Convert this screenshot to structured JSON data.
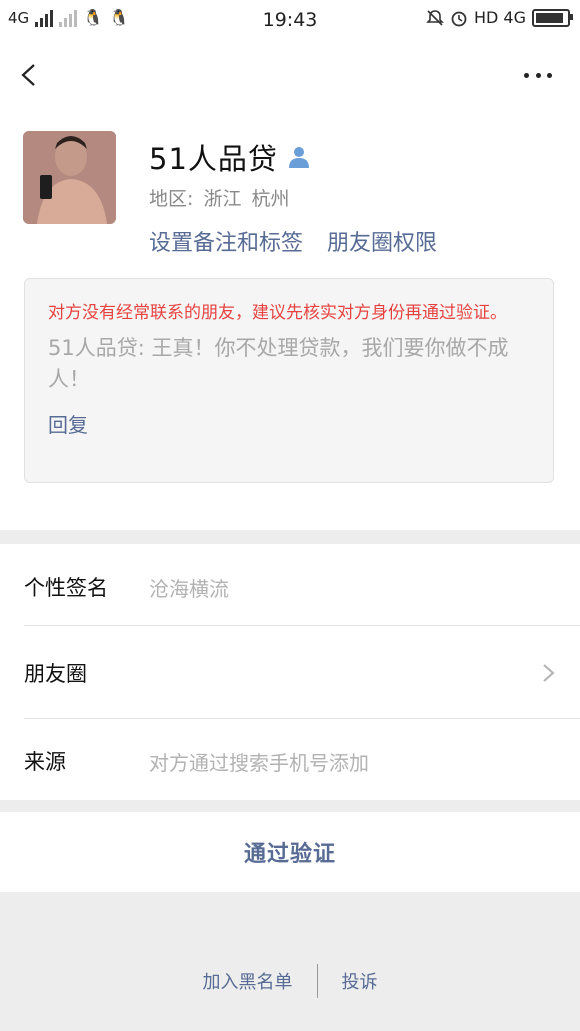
{
  "status_bar": {
    "carrier_left": "4G",
    "time": "19:43",
    "network_right": "HD 4G"
  },
  "nav": {
    "back_icon": "chevron-left-icon",
    "more_icon": "more-dots-icon"
  },
  "profile": {
    "nickname": "51人品贷",
    "region_label": "地区:",
    "region_province": "浙江",
    "region_city": "杭州",
    "set_remark_label": "设置备注和标签",
    "moments_permission_label": "朋友圈权限"
  },
  "verification": {
    "warning": "对方没有经常联系的朋友，建议先核实对方身份再通过验证。",
    "message": "51人品贷: 王真！你不处理贷款，我们要你做不成人！",
    "reply_label": "回复"
  },
  "info_rows": {
    "signature_label": "个性签名",
    "signature_value": "沧海横流",
    "moments_label": "朋友圈",
    "source_label": "来源",
    "source_value": "对方通过搜索手机号添加"
  },
  "actions": {
    "approve_label": "通过验证",
    "blacklist_label": "加入黑名单",
    "report_label": "投诉"
  },
  "colors": {
    "link": "#576b95",
    "warning": "#e64340",
    "background": "#ededed"
  }
}
